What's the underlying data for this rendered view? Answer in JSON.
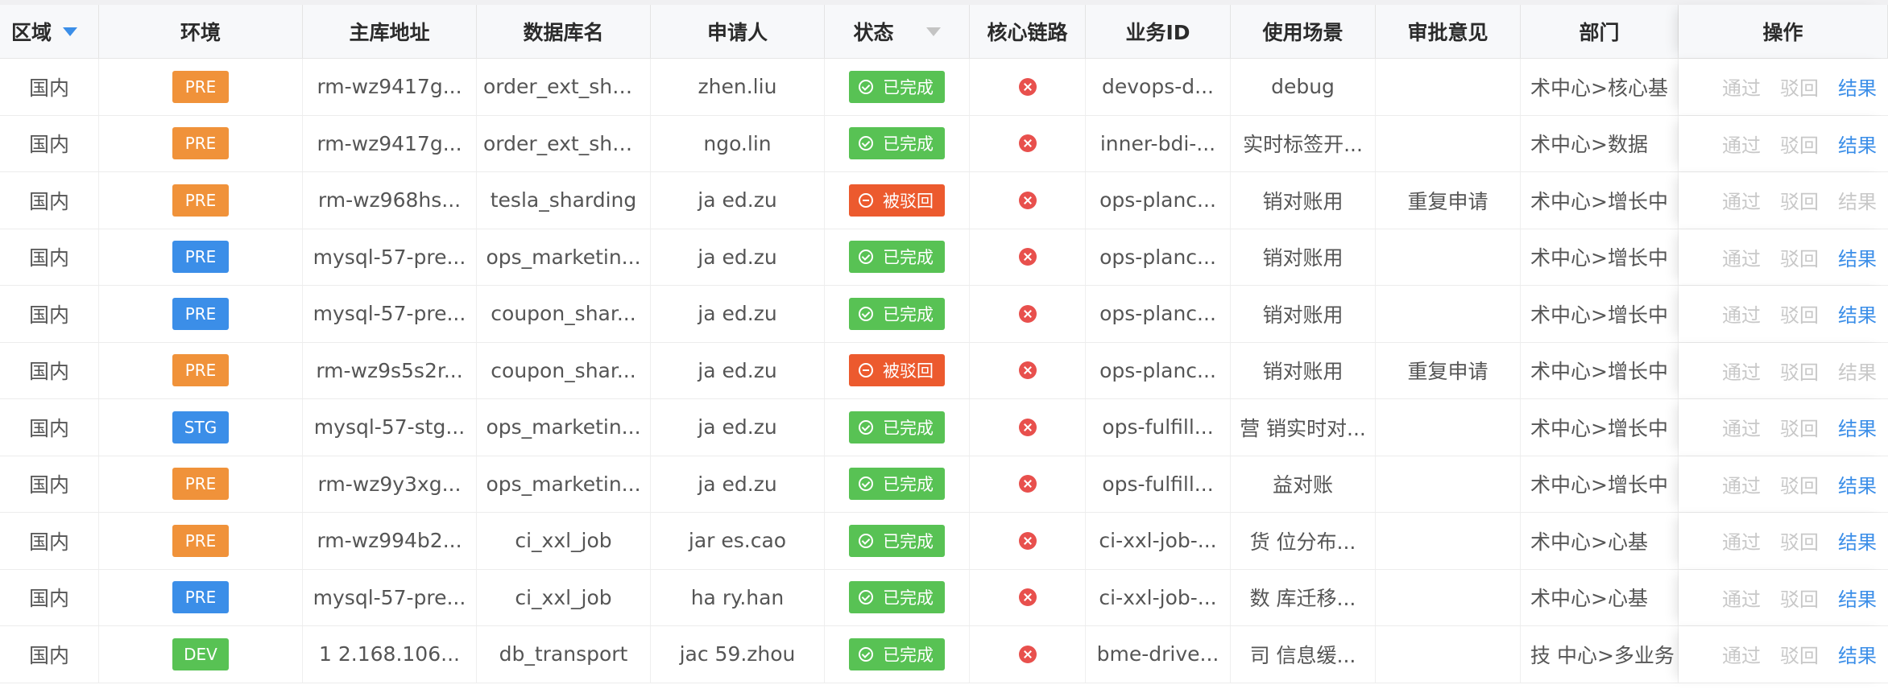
{
  "headers": [
    "区域",
    "环境",
    "主库地址",
    "数据库名",
    "申请人",
    "状态",
    "核心链路",
    "业务ID",
    "使用场景",
    "审批意见",
    "部门",
    "操作"
  ],
  "colors": {
    "orange": "#f0923a",
    "blue": "#3b8ee8",
    "green": "#58c254",
    "red": "#ec5a2e",
    "link": "#3b8ee8",
    "disabled": "#c8c8c8"
  },
  "icons": {
    "region_filter": "filter-icon",
    "status_filter": "filter-icon",
    "core": "close-circle-icon",
    "done": "check-circle-icon",
    "rejected": "minus-circle-icon"
  },
  "actions": {
    "approve": "通过",
    "reject": "驳回",
    "result": "结果"
  },
  "rows": [
    {
      "region": "国内",
      "env": "PRE",
      "env_color": "orange",
      "host": "rm-wz9417g...",
      "db": "order_ext_sha...",
      "applicant": "zhen.liu",
      "status": "已完成",
      "status_type": "done",
      "biz": "devops-d...",
      "scene": "debug",
      "comment": "",
      "dept": "术中心>核心基",
      "result_active": true
    },
    {
      "region": "国内",
      "env": "PRE",
      "env_color": "orange",
      "host": "rm-wz9417g...",
      "db": "order_ext_sha...",
      "applicant": "ngo.lin",
      "status": "已完成",
      "status_type": "done",
      "biz": "inner-bdi-...",
      "scene": "实时标签开...",
      "comment": "",
      "dept": "术中心>数据",
      "result_active": true
    },
    {
      "region": "国内",
      "env": "PRE",
      "env_color": "orange",
      "host": "rm-wz968hs...",
      "db": "tesla_sharding",
      "applicant": "ja ed.zu",
      "status": "被驳回",
      "status_type": "rejected",
      "biz": "ops-planc...",
      "scene": "销对账用",
      "comment": "重复申请",
      "dept": "术中心>增长中",
      "result_active": false
    },
    {
      "region": "国内",
      "env": "PRE",
      "env_color": "blue",
      "host": "mysql-57-pre...",
      "db": "ops_marketin...",
      "applicant": "ja ed.zu",
      "status": "已完成",
      "status_type": "done",
      "biz": "ops-planc...",
      "scene": "销对账用",
      "comment": "",
      "dept": "术中心>增长中",
      "result_active": true
    },
    {
      "region": "国内",
      "env": "PRE",
      "env_color": "blue",
      "host": "mysql-57-pre...",
      "db": "coupon_shar...",
      "applicant": "ja ed.zu",
      "status": "已完成",
      "status_type": "done",
      "biz": "ops-planc...",
      "scene": "销对账用",
      "comment": "",
      "dept": "术中心>增长中",
      "result_active": true
    },
    {
      "region": "国内",
      "env": "PRE",
      "env_color": "orange",
      "host": "rm-wz9s5s2r...",
      "db": "coupon_shar...",
      "applicant": "ja ed.zu",
      "status": "被驳回",
      "status_type": "rejected",
      "biz": "ops-planc...",
      "scene": "销对账用",
      "comment": "重复申请",
      "dept": "术中心>增长中",
      "result_active": false
    },
    {
      "region": "国内",
      "env": "STG",
      "env_color": "blue",
      "host": "mysql-57-stg...",
      "db": "ops_marketin...",
      "applicant": "ja ed.zu",
      "status": "已完成",
      "status_type": "done",
      "biz": "ops-fulfill...",
      "scene": "营 销实时对...",
      "comment": "",
      "dept": "术中心>增长中",
      "result_active": true
    },
    {
      "region": "国内",
      "env": "PRE",
      "env_color": "orange",
      "host": "rm-wz9y3xg...",
      "db": "ops_marketin...",
      "applicant": "ja ed.zu",
      "status": "已完成",
      "status_type": "done",
      "biz": "ops-fulfill...",
      "scene": "益对账",
      "comment": "",
      "dept": "术中心>增长中",
      "result_active": true
    },
    {
      "region": "国内",
      "env": "PRE",
      "env_color": "orange",
      "host": "rm-wz994b2...",
      "db": "ci_xxl_job",
      "applicant": "jar es.cao",
      "status": "已完成",
      "status_type": "done",
      "biz": "ci-xxl-job-...",
      "scene": "货 位分布...",
      "comment": "",
      "dept": "术中心>心基",
      "result_active": true
    },
    {
      "region": "国内",
      "env": "PRE",
      "env_color": "blue",
      "host": "mysql-57-pre...",
      "db": "ci_xxl_job",
      "applicant": "ha ry.han",
      "status": "已完成",
      "status_type": "done",
      "biz": "ci-xxl-job-...",
      "scene": "数 库迁移...",
      "comment": "",
      "dept": "术中心>心基",
      "result_active": true
    },
    {
      "region": "国内",
      "env": "DEV",
      "env_color": "green",
      "host": "1 2.168.106...",
      "db": "db_transport",
      "applicant": "jac 59.zhou",
      "status": "已完成",
      "status_type": "done",
      "biz": "bme-drive...",
      "scene": "司 信息缓...",
      "comment": "",
      "dept": "技 中心>多业务",
      "result_active": true
    }
  ]
}
